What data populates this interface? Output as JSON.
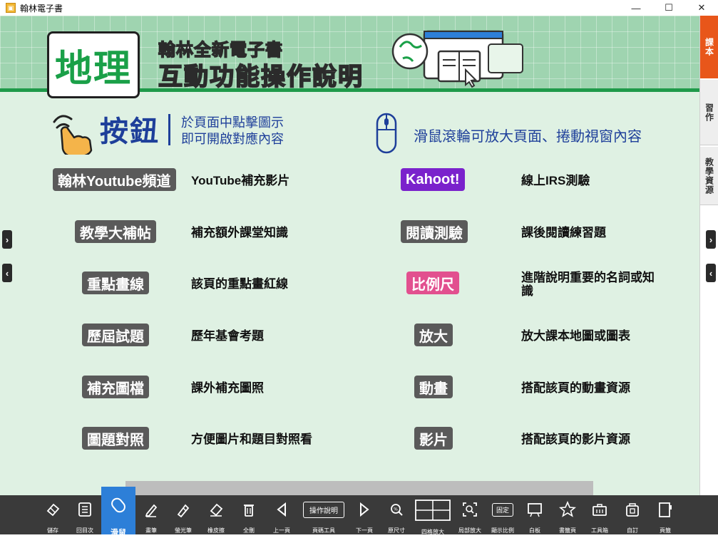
{
  "window": {
    "title": "翰林電子書",
    "minimize": "—",
    "maximize": "☐",
    "close": "✕"
  },
  "header": {
    "subject": "地理",
    "subtitle": "翰林全新電子書",
    "title": "互動功能操作說明"
  },
  "sections": {
    "button_title": "按鈕",
    "button_desc_line1": "於頁面中點擊圖示",
    "button_desc_line2": "即可開啟對應內容",
    "mouse_text": "滑鼠滾輪可放大頁面、捲動視窗內容"
  },
  "features_left": [
    {
      "badge": "翰林Youtube頻道",
      "desc": "YouTube補充影片",
      "color": "gray"
    },
    {
      "badge": "教學大補帖",
      "desc": "補充額外課堂知識",
      "color": "gray"
    },
    {
      "badge": "重點畫線",
      "desc": "該頁的重點畫紅線",
      "color": "gray"
    },
    {
      "badge": "歷屆試題",
      "desc": "歷年基會考題",
      "color": "gray"
    },
    {
      "badge": "補充圖檔",
      "desc": "課外補充圖照",
      "color": "gray"
    },
    {
      "badge": "圖題對照",
      "desc": "方便圖片和題目對照看",
      "color": "gray"
    }
  ],
  "features_right": [
    {
      "badge": "Kahoot!",
      "desc": "線上IRS測驗",
      "color": "purple"
    },
    {
      "badge": "閱讀測驗",
      "desc": "課後閱讀練習題",
      "color": "gray"
    },
    {
      "badge": "比例尺",
      "desc": "進階說明重要的名詞或知識",
      "color": "pink"
    },
    {
      "badge": "放大",
      "desc": "放大課本地圖或圖表",
      "color": "gray"
    },
    {
      "badge": "動畫",
      "desc": "搭配該頁的動畫資源",
      "color": "gray"
    },
    {
      "badge": "影片",
      "desc": "搭配該頁的影片資源",
      "color": "gray"
    }
  ],
  "side_tabs": [
    {
      "label": "課本",
      "active": true
    },
    {
      "label": "習作",
      "active": false
    },
    {
      "label": "教學資源",
      "active": false
    }
  ],
  "arrows": {
    "next": "›",
    "prev": "‹"
  },
  "toolbar": [
    {
      "label": "儲存",
      "icon": "save-icon"
    },
    {
      "label": "回目次",
      "icon": "toc-icon"
    },
    {
      "label": "滑鼠",
      "icon": "mouse-pointer-icon",
      "active": true
    },
    {
      "label": "畫筆",
      "icon": "pen-icon"
    },
    {
      "label": "螢光筆",
      "icon": "highlighter-icon"
    },
    {
      "label": "橡皮擦",
      "icon": "eraser-icon"
    },
    {
      "label": "全刪",
      "icon": "trash-icon"
    },
    {
      "label": "上一頁",
      "icon": "prev-page-icon"
    },
    {
      "label": "頁碼工具",
      "icon": "page-tool-icon",
      "box_text": "操作說明"
    },
    {
      "label": "下一頁",
      "icon": "next-page-icon"
    },
    {
      "label": "原尺寸",
      "icon": "original-size-icon"
    },
    {
      "label": "四格放大",
      "icon": "four-grid-icon"
    },
    {
      "label": "局部放大",
      "icon": "zoom-area-icon"
    },
    {
      "label": "顯示比例",
      "icon": "display-ratio-icon",
      "box_text": "固定"
    },
    {
      "label": "白板",
      "icon": "whiteboard-icon"
    },
    {
      "label": "書籤頁",
      "icon": "bookmark-star-icon"
    },
    {
      "label": "工具箱",
      "icon": "toolbox-icon"
    },
    {
      "label": "自訂",
      "icon": "custom-icon"
    },
    {
      "label": "頁籤",
      "icon": "page-tab-icon"
    }
  ],
  "colors": {
    "header_green": "#9fd4b0",
    "page_bg": "#dff1e3",
    "text_blue": "#1e3f9a",
    "active_tab": "#e8561a",
    "toolbar_bg": "#3a3a3a",
    "toolbar_active": "#2d7fd8"
  }
}
